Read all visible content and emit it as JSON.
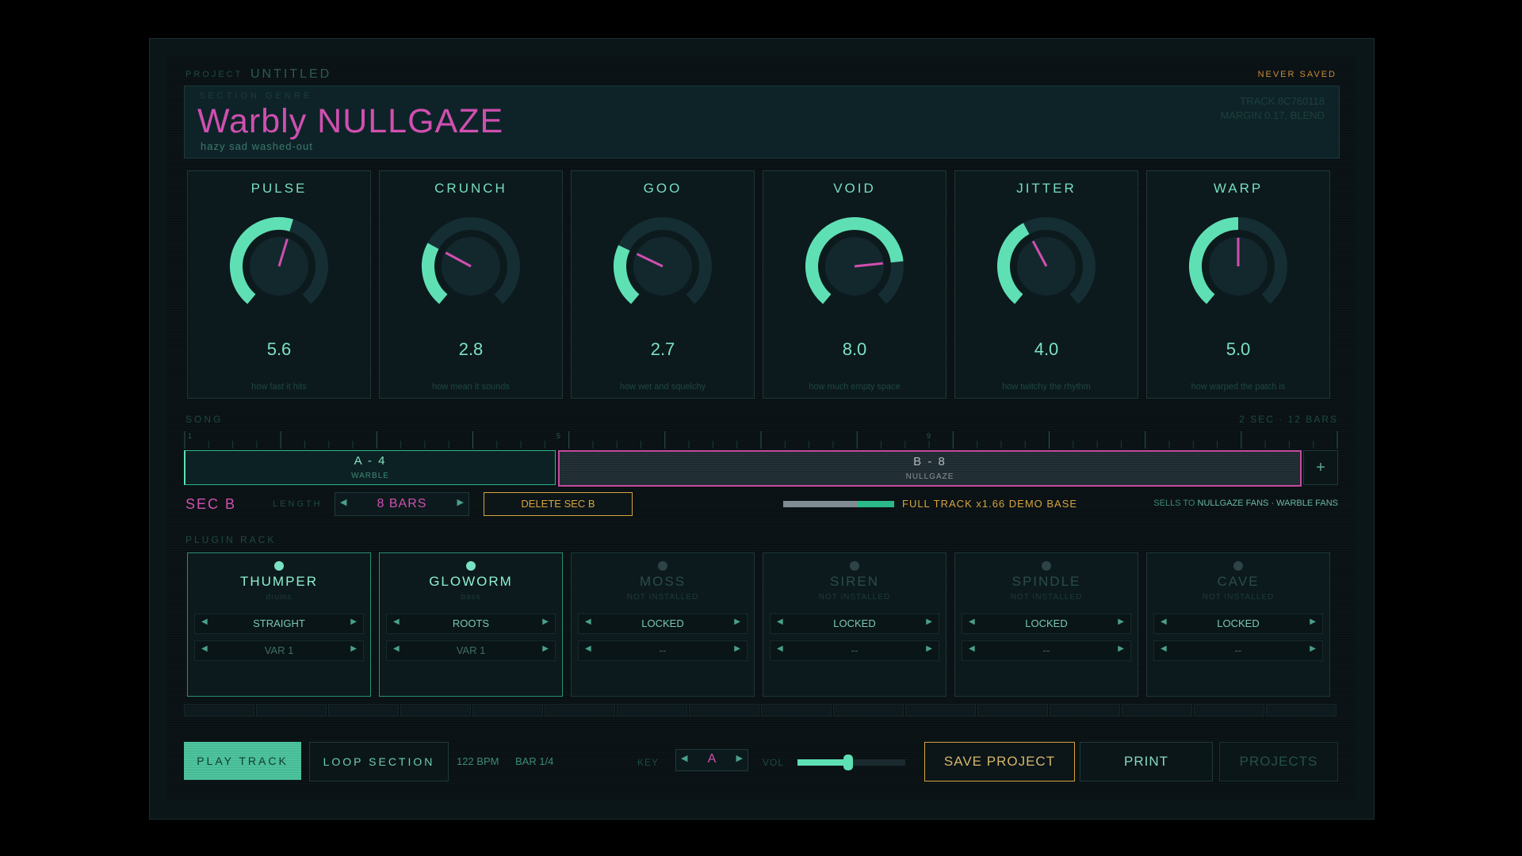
{
  "header": {
    "project_label": "PROJECT",
    "project_name": "UNTITLED",
    "save_status": "NEVER SAVED"
  },
  "genre": {
    "label": "SECTION GENRE",
    "name": "Warbly NULLGAZE",
    "description": "hazy sad washed-out",
    "track_id": "TRACK 8C760118",
    "track_meta": "MARGIN 0.17, BLEND"
  },
  "knobs": [
    {
      "name": "PULSE",
      "value": "5.6",
      "level": 0.56,
      "desc": "how fast it hits"
    },
    {
      "name": "CRUNCH",
      "value": "2.8",
      "level": 0.28,
      "desc": "how mean it sounds"
    },
    {
      "name": "GOO",
      "value": "2.7",
      "level": 0.27,
      "desc": "how wet and squelchy"
    },
    {
      "name": "VOID",
      "value": "8.0",
      "level": 0.8,
      "desc": "how much empty space"
    },
    {
      "name": "JITTER",
      "value": "4.0",
      "level": 0.4,
      "desc": "how twitchy the rhythm"
    },
    {
      "name": "WARP",
      "value": "5.0",
      "level": 0.5,
      "desc": "how warped the patch is"
    }
  ],
  "song": {
    "label": "SONG",
    "summary": "2 SEC  ·  12 BARS",
    "ruler_marks": [
      "1",
      "5",
      "9"
    ],
    "sections": [
      {
        "title": "A - 4",
        "genre": "WARBLE"
      },
      {
        "title": "B - 8",
        "genre": "NULLGAZE"
      }
    ],
    "add_label": "+"
  },
  "section_edit": {
    "name": "SEC B",
    "length_label": "LENGTH",
    "length_value": "8 BARS",
    "delete_label": "DELETE SEC B",
    "full_track": "FULL TRACK x1.66 DEMO BASE",
    "meter_level": 0.67,
    "sells_to_label": "SELLS TO",
    "sells_to_fans": "NULLGAZE FANS · WARBLE FANS"
  },
  "plugin_rack": {
    "label": "PLUGIN RACK",
    "plugins": [
      {
        "name": "THUMPER",
        "type": "drums",
        "style": "STRAIGHT",
        "variant": "VAR 1",
        "installed": true
      },
      {
        "name": "GLOWORM",
        "type": "bass",
        "style": "ROOTS",
        "variant": "VAR 1",
        "installed": true
      },
      {
        "name": "MOSS",
        "type": "NOT INSTALLED",
        "style": "LOCKED",
        "variant": "--",
        "installed": false
      },
      {
        "name": "SIREN",
        "type": "NOT INSTALLED",
        "style": "LOCKED",
        "variant": "--",
        "installed": false
      },
      {
        "name": "SPINDLE",
        "type": "NOT INSTALLED",
        "style": "LOCKED",
        "variant": "--",
        "installed": false
      },
      {
        "name": "CAVE",
        "type": "NOT INSTALLED",
        "style": "LOCKED",
        "variant": "--",
        "installed": false
      }
    ]
  },
  "transport": {
    "play_label": "PLAY TRACK",
    "loop_label": "LOOP SECTION",
    "bpm": "122 BPM",
    "bar": "BAR 1/4",
    "key_label": "KEY",
    "key_value": "A",
    "vol_label": "VOL",
    "volume": 0.47,
    "save_label": "SAVE PROJECT",
    "print_label": "PRINT",
    "projects_label": "PROJECTS"
  },
  "colors": {
    "accent": "#5fe0b4",
    "magenta": "#d04fb0",
    "amber": "#d7a43e",
    "background": "#091114"
  }
}
